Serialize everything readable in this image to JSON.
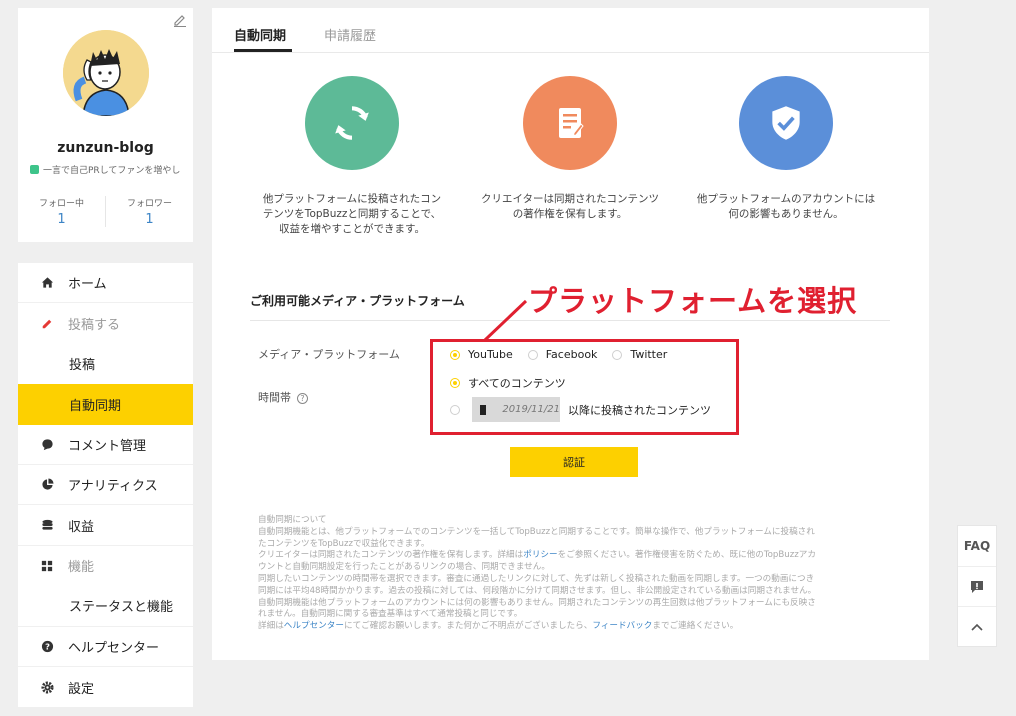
{
  "profile": {
    "username": "zunzun-blog",
    "bio": "一言で自己PRしてファンを増やし",
    "following_label": "フォロー中",
    "following_count": "1",
    "followers_label": "フォロワー",
    "followers_count": "1"
  },
  "nav": {
    "home": "ホーム",
    "post": "投稿する",
    "post_sub": "投稿",
    "auto_sync": "自動同期",
    "comments": "コメント管理",
    "analytics": "アナリティクス",
    "revenue": "収益",
    "features": "機能",
    "status_features": "ステータスと機能",
    "help_center": "ヘルプセンター",
    "settings": "設定"
  },
  "tabs": {
    "auto_sync": "自動同期",
    "history": "申請履歴"
  },
  "features": [
    {
      "text": "他プラットフォームに投稿されたコンテンツをTopBuzzと同期することで、収益を増やすことができます。",
      "color": "#5dba97"
    },
    {
      "text": "クリエイターは同期されたコンテンツの著作権を保有します。",
      "color": "#f08a5d"
    },
    {
      "text": "他プラットフォームのアカウントには何の影響もありません。",
      "color": "#5b8fd9"
    }
  ],
  "section_title": "ご利用可能メディア・プラットフォーム",
  "form": {
    "platform_label": "メディア・プラットフォーム",
    "platforms": [
      "YouTube",
      "Facebook",
      "Twitter"
    ],
    "selected_platform": "YouTube",
    "time_label": "時間帯",
    "all_content": "すべてのコンテンツ",
    "date_value": "2019/11/21",
    "after_date": "以降に投稿されたコンテンツ"
  },
  "verify_button": "認証",
  "info": {
    "title": "自動同期について",
    "l1": "自動同期機能とは、他プラットフォームでのコンテンツを一括してTopBuzzと同期することです。簡単な操作で、他プラットフォームに投稿され",
    "l2": "たコンテンツをTopBuzzで収益化できます。",
    "l3a": "クリエイターは同期されたコンテンツの著作権を保有します。詳細は",
    "policy_link": "ポリシー",
    "l3b": "をご参照ください。著作権侵害を防ぐため、既に他のTopBuzzアカ",
    "l4": "ウントと自動同期設定を行ったことがあるリンクの場合、同期できません。",
    "l5": "同期したいコンテンツの時間帯を選択できます。審査に通過したリンクに対して、先ずは新しく投稿された動画を同期します。一つの動画につき",
    "l6": "同期には平均48時間かかります。過去の投稿に対しては、何段階かに分けて同期させます。但し、非公開設定されている動画は同期されません。",
    "l7": "自動同期機能は他プラットフォームのアカウントには何の影響もありません。同期されたコンテンツの再生回数は他プラットフォームにも反映さ",
    "l8": "れません。自動同期に関する審査基準はすべて通常投稿と同じです。",
    "l9a": "詳細は",
    "help_link": "ヘルプセンター",
    "l9b": "にてご確認お願いします。また何かご不明点がございましたら、",
    "feedback_link": "フィードバック",
    "l9c": "までご連絡ください。"
  },
  "annotation": "プラットフォームを選択",
  "float": {
    "faq": "FAQ"
  },
  "colors": {
    "accent": "#fdd000",
    "highlight_red": "#e02030",
    "link": "#3d85c6"
  }
}
